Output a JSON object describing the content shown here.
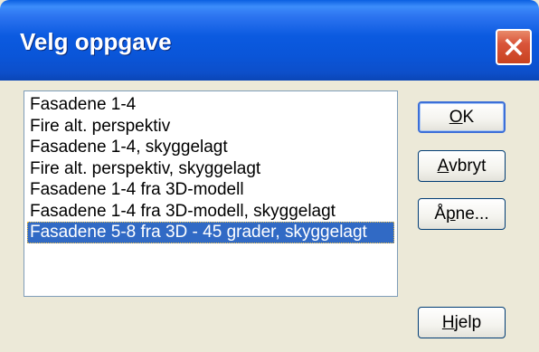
{
  "window": {
    "title": "Velg oppgave",
    "close_icon": "close-icon"
  },
  "list": {
    "items": [
      "Fasadene 1-4",
      "Fire alt. perspektiv",
      "Fasadene 1-4, skyggelagt",
      "Fire alt. perspektiv, skyggelagt",
      "Fasadene 1-4 fra 3D-modell",
      "Fasadene 1-4 fra 3D-modell, skyggelagt",
      "Fasadene 5-8 fra 3D - 45 grader, skyggelagt"
    ],
    "selected_index": 6
  },
  "buttons": {
    "ok": {
      "accel": "O",
      "rest": "K"
    },
    "cancel": {
      "accel": "A",
      "rest": "vbryt"
    },
    "open": {
      "pre": "Å",
      "accel": "p",
      "rest": "ne..."
    },
    "help": {
      "accel": "H",
      "rest": "jelp"
    }
  },
  "colors": {
    "titlebar": "#0b5ae0",
    "selection": "#316ac5",
    "close_button": "#d9553a",
    "face": "#ece9d8"
  }
}
